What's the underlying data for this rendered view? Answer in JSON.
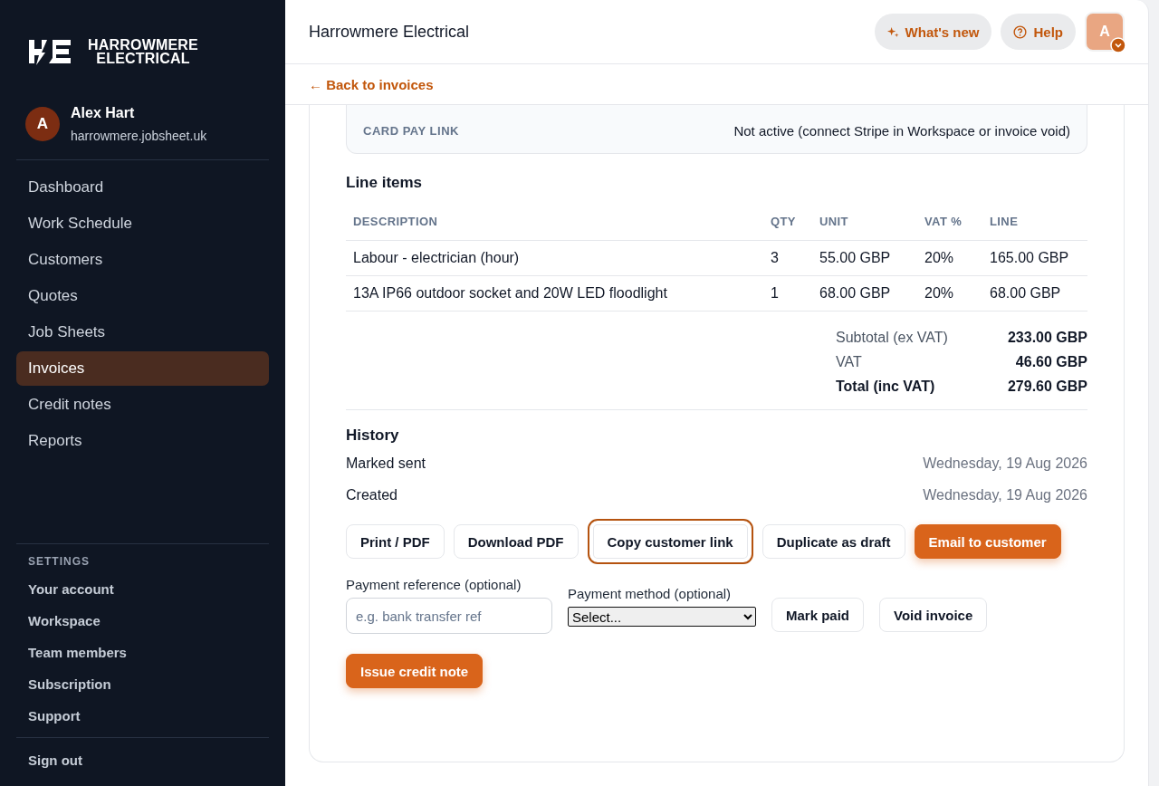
{
  "brand": {
    "name": "HARROWMERE ELECTRICAL"
  },
  "user": {
    "initial": "A",
    "name": "Alex Hart",
    "domain": "harrowmere.jobsheet.uk"
  },
  "nav": [
    {
      "label": "Dashboard",
      "selected": false
    },
    {
      "label": "Work Schedule",
      "selected": false
    },
    {
      "label": "Customers",
      "selected": false
    },
    {
      "label": "Quotes",
      "selected": false
    },
    {
      "label": "Job Sheets",
      "selected": false
    },
    {
      "label": "Invoices",
      "selected": true
    },
    {
      "label": "Credit notes",
      "selected": false
    },
    {
      "label": "Reports",
      "selected": false
    }
  ],
  "settings": {
    "heading": "SETTINGS",
    "items": [
      "Your account",
      "Workspace",
      "Team members",
      "Subscription",
      "Support"
    ]
  },
  "sign_out": "Sign out",
  "header": {
    "title": "Harrowmere Electrical",
    "whats_new": "What's new",
    "help": "Help",
    "avatar": "A"
  },
  "back_link": "← Back to invoices",
  "card_pay": {
    "label": "CARD PAY LINK",
    "value": "Not active (connect Stripe in Workspace or invoice void)"
  },
  "line_items": {
    "title": "Line items",
    "columns": [
      "DESCRIPTION",
      "QTY",
      "UNIT",
      "VAT %",
      "LINE"
    ],
    "rows": [
      [
        "Labour - electrician (hour)",
        "3",
        "55.00 GBP",
        "20%",
        "165.00 GBP"
      ],
      [
        "13A IP66 outdoor socket and 20W LED floodlight",
        "1",
        "68.00 GBP",
        "20%",
        "68.00 GBP"
      ]
    ]
  },
  "totals": [
    {
      "label": "Subtotal (ex VAT)",
      "value": "233.00 GBP",
      "strong": false
    },
    {
      "label": "VAT",
      "value": "46.60 GBP",
      "strong": false
    },
    {
      "label": "Total (inc VAT)",
      "value": "279.60 GBP",
      "strong": true
    }
  ],
  "history": {
    "title": "History",
    "events": [
      {
        "label": "Marked sent",
        "date": "Wednesday, 19 Aug 2026"
      },
      {
        "label": "Created",
        "date": "Wednesday, 19 Aug 2026"
      }
    ]
  },
  "actions": [
    {
      "label": "Print / PDF",
      "primary": false,
      "focused": false
    },
    {
      "label": "Download PDF",
      "primary": false,
      "focused": false
    },
    {
      "label": "Copy customer link",
      "primary": false,
      "focused": true
    },
    {
      "label": "Duplicate as draft",
      "primary": false,
      "focused": false
    },
    {
      "label": "Email to customer",
      "primary": true,
      "focused": false
    }
  ],
  "payment_reference": {
    "label": "Payment reference (optional)",
    "placeholder": "e.g. bank transfer ref"
  },
  "payment_method": {
    "label": "Payment method (optional)",
    "value": "Select..."
  },
  "payment_buttons": [
    "Mark paid",
    "Void invoice"
  ],
  "credit_button": "Issue credit note"
}
